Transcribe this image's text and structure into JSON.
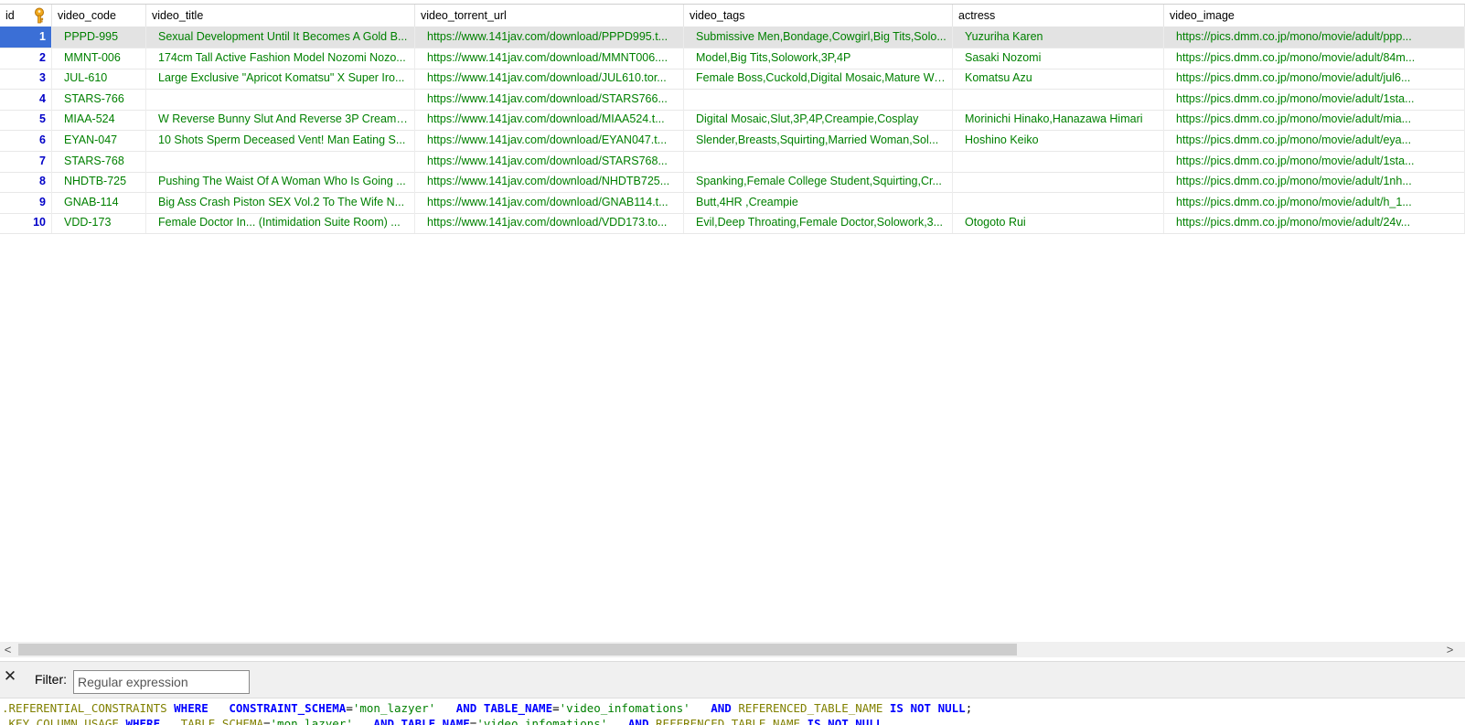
{
  "grid": {
    "columns": [
      "id",
      "video_code",
      "video_title",
      "video_torrent_url",
      "video_tags",
      "actress",
      "video_image"
    ],
    "rows": [
      {
        "id": "1",
        "video_code": "PPPD-995",
        "video_title": "Sexual Development Until It Becomes A Gold B...",
        "video_torrent_url": "https://www.141jav.com/download/PPPD995.t...",
        "video_tags": "Submissive Men,Bondage,Cowgirl,Big Tits,Solo...",
        "actress": "Yuzuriha Karen",
        "video_image": "https://pics.dmm.co.jp/mono/movie/adult/ppp..."
      },
      {
        "id": "2",
        "video_code": "MMNT-006",
        "video_title": "174cm Tall Active Fashion Model Nozomi Nozo...",
        "video_torrent_url": "https://www.141jav.com/download/MMNT006....",
        "video_tags": "Model,Big Tits,Solowork,3P,4P",
        "actress": "Sasaki Nozomi",
        "video_image": "https://pics.dmm.co.jp/mono/movie/adult/84m..."
      },
      {
        "id": "3",
        "video_code": "JUL-610",
        "video_title": "Large Exclusive \"Apricot Komatsu\" X Super Iro...",
        "video_torrent_url": "https://www.141jav.com/download/JUL610.tor...",
        "video_tags": "Female Boss,Cuckold,Digital Mosaic,Mature Wo...",
        "actress": "Komatsu Azu",
        "video_image": "https://pics.dmm.co.jp/mono/movie/adult/jul6..."
      },
      {
        "id": "4",
        "video_code": "STARS-766",
        "video_title": "",
        "video_torrent_url": "https://www.141jav.com/download/STARS766...",
        "video_tags": "",
        "actress": "",
        "video_image": "https://pics.dmm.co.jp/mono/movie/adult/1sta..."
      },
      {
        "id": "5",
        "video_code": "MIAA-524",
        "video_title": "W Reverse Bunny Slut And Reverse 3P Creamp...",
        "video_torrent_url": "https://www.141jav.com/download/MIAA524.t...",
        "video_tags": "Digital Mosaic,Slut,3P,4P,Creampie,Cosplay",
        "actress": "Morinichi Hinako,Hanazawa Himari",
        "video_image": "https://pics.dmm.co.jp/mono/movie/adult/mia..."
      },
      {
        "id": "6",
        "video_code": "EYAN-047",
        "video_title": "10 Shots Sperm Deceased Vent! Man Eating S...",
        "video_torrent_url": "https://www.141jav.com/download/EYAN047.t...",
        "video_tags": "Slender,Breasts,Squirting,Married Woman,Sol...",
        "actress": "Hoshino Keiko",
        "video_image": "https://pics.dmm.co.jp/mono/movie/adult/eya..."
      },
      {
        "id": "7",
        "video_code": "STARS-768",
        "video_title": "",
        "video_torrent_url": "https://www.141jav.com/download/STARS768...",
        "video_tags": "",
        "actress": "",
        "video_image": "https://pics.dmm.co.jp/mono/movie/adult/1sta..."
      },
      {
        "id": "8",
        "video_code": "NHDTB-725",
        "video_title": "Pushing The Waist Of A Woman Who Is Going ...",
        "video_torrent_url": "https://www.141jav.com/download/NHDTB725...",
        "video_tags": "Spanking,Female College Student,Squirting,Cr...",
        "actress": "",
        "video_image": "https://pics.dmm.co.jp/mono/movie/adult/1nh..."
      },
      {
        "id": "9",
        "video_code": "GNAB-114",
        "video_title": "Big Ass Crash Piston SEX Vol.2 To The Wife N...",
        "video_torrent_url": "https://www.141jav.com/download/GNAB114.t...",
        "video_tags": "Butt,4HR ,Creampie",
        "actress": "",
        "video_image": "https://pics.dmm.co.jp/mono/movie/adult/h_1..."
      },
      {
        "id": "10",
        "video_code": "VDD-173",
        "video_title": "Female Doctor In... (Intimidation Suite Room) ...",
        "video_torrent_url": "https://www.141jav.com/download/VDD173.to...",
        "video_tags": "Evil,Deep Throating,Female Doctor,Solowork,3...",
        "actress": "Otogoto Rui",
        "video_image": "https://pics.dmm.co.jp/mono/movie/adult/24v..."
      }
    ],
    "selected_row": 1
  },
  "scrollbar": {
    "left_arrow": "<",
    "right_arrow": ">"
  },
  "filter": {
    "close_glyph": "✕",
    "label": "Filter:",
    "placeholder": "Regular expression",
    "value": ""
  },
  "sql": {
    "line1": [
      {
        "t": ".REFERENTIAL_CONSTRAINTS ",
        "c": "id2"
      },
      {
        "t": "WHERE",
        "c": "kw"
      },
      {
        "t": "   CONSTRAINT_SCHEMA",
        "c": "kw"
      },
      {
        "t": "=",
        "c": "op"
      },
      {
        "t": "'mon_lazyer'",
        "c": "str"
      },
      {
        "t": "   AND ",
        "c": "kw"
      },
      {
        "t": "TABLE_NAME",
        "c": "kw"
      },
      {
        "t": "=",
        "c": "op"
      },
      {
        "t": "'video_infomations'",
        "c": "str"
      },
      {
        "t": "   AND ",
        "c": "kw"
      },
      {
        "t": "REFERENCED_TABLE_NAME ",
        "c": "id2"
      },
      {
        "t": "IS NOT NULL",
        "c": "kw"
      },
      {
        "t": ";",
        "c": "op"
      }
    ],
    "line2": [
      {
        "t": ".KEY_COLUMN_USAGE ",
        "c": "id2"
      },
      {
        "t": "WHERE",
        "c": "kw"
      },
      {
        "t": "   TABLE_SCHEMA",
        "c": "id2"
      },
      {
        "t": "=",
        "c": "op"
      },
      {
        "t": "'mon_lazyer'",
        "c": "str"
      },
      {
        "t": "   AND ",
        "c": "kw"
      },
      {
        "t": "TABLE_NAME",
        "c": "kw"
      },
      {
        "t": "=",
        "c": "op"
      },
      {
        "t": "'video_infomations'",
        "c": "str"
      },
      {
        "t": "   AND ",
        "c": "kw"
      },
      {
        "t": "REFERENCED_TABLE_NAME ",
        "c": "id2"
      },
      {
        "t": "IS NOT NULL",
        "c": "kw"
      }
    ]
  },
  "icons": {
    "primary_key": "key-icon"
  },
  "colors": {
    "cell_text": "#008000",
    "id_text": "#0000c8",
    "selected_id_bg": "#3b6fd6",
    "selected_row_bg": "#e3e3e3"
  }
}
